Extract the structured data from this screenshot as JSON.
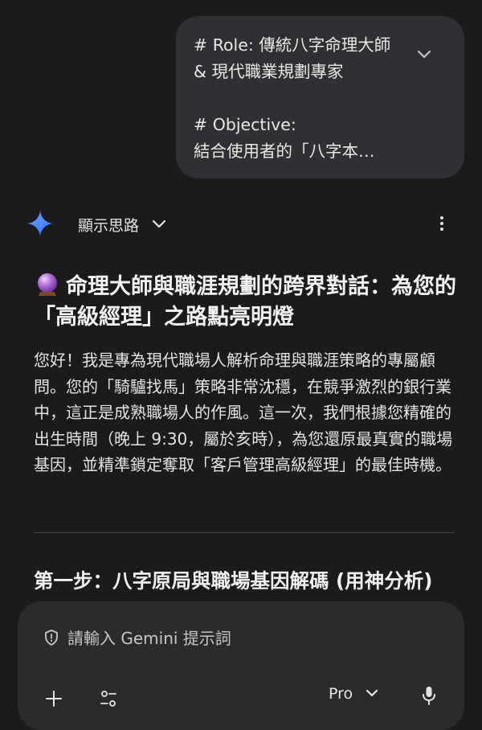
{
  "user_prompt": {
    "text": "# Role: 傳統八字命理大師\n& 現代職業規劃專家\n\n# Objective:\n結合使用者的「八字本…",
    "expand_icon": "chevron-down-icon"
  },
  "response_header": {
    "avatar_icon": "gemini-sparkle-icon",
    "show_thinking_label": "顯示思路",
    "show_thinking_icon": "chevron-down-icon",
    "more_icon": "more-vert-icon"
  },
  "response": {
    "heading_emoji": "crystal-ball-icon",
    "heading": "命理大師與職涯規劃的跨界對話：為您的「高級經理」之路點亮明燈",
    "paragraph": "您好！我是專為現代職場人解析命理與職涯策略的專屬顧問。您的「騎驢找馬」策略非常沈穩，在競爭激烈的銀行業中，這正是成熟職場人的作風。這一次，我們根據您精確的出生時間（晚上 9:30，屬於亥時），為您還原最真實的職場基因，並精準鎖定奪取「客戶管理高級經理」的最佳時機。",
    "step_heading": "第一步：八字原局與職場基因解碼 (用神分析)"
  },
  "composer": {
    "placeholder": "請輸入 Gemini 提示詞",
    "input_icon": "shield-icon",
    "add_icon": "plus-icon",
    "tools_icon": "tune-icon",
    "model_label": "Pro",
    "model_icon": "chevron-down-icon",
    "mic_icon": "mic-icon"
  },
  "colors": {
    "background": "#1b1b1d",
    "bubble": "#2f3033",
    "composer": "#2a2b2d",
    "text": "#e3e3e3",
    "gemini_blue": "#4a90ff"
  }
}
